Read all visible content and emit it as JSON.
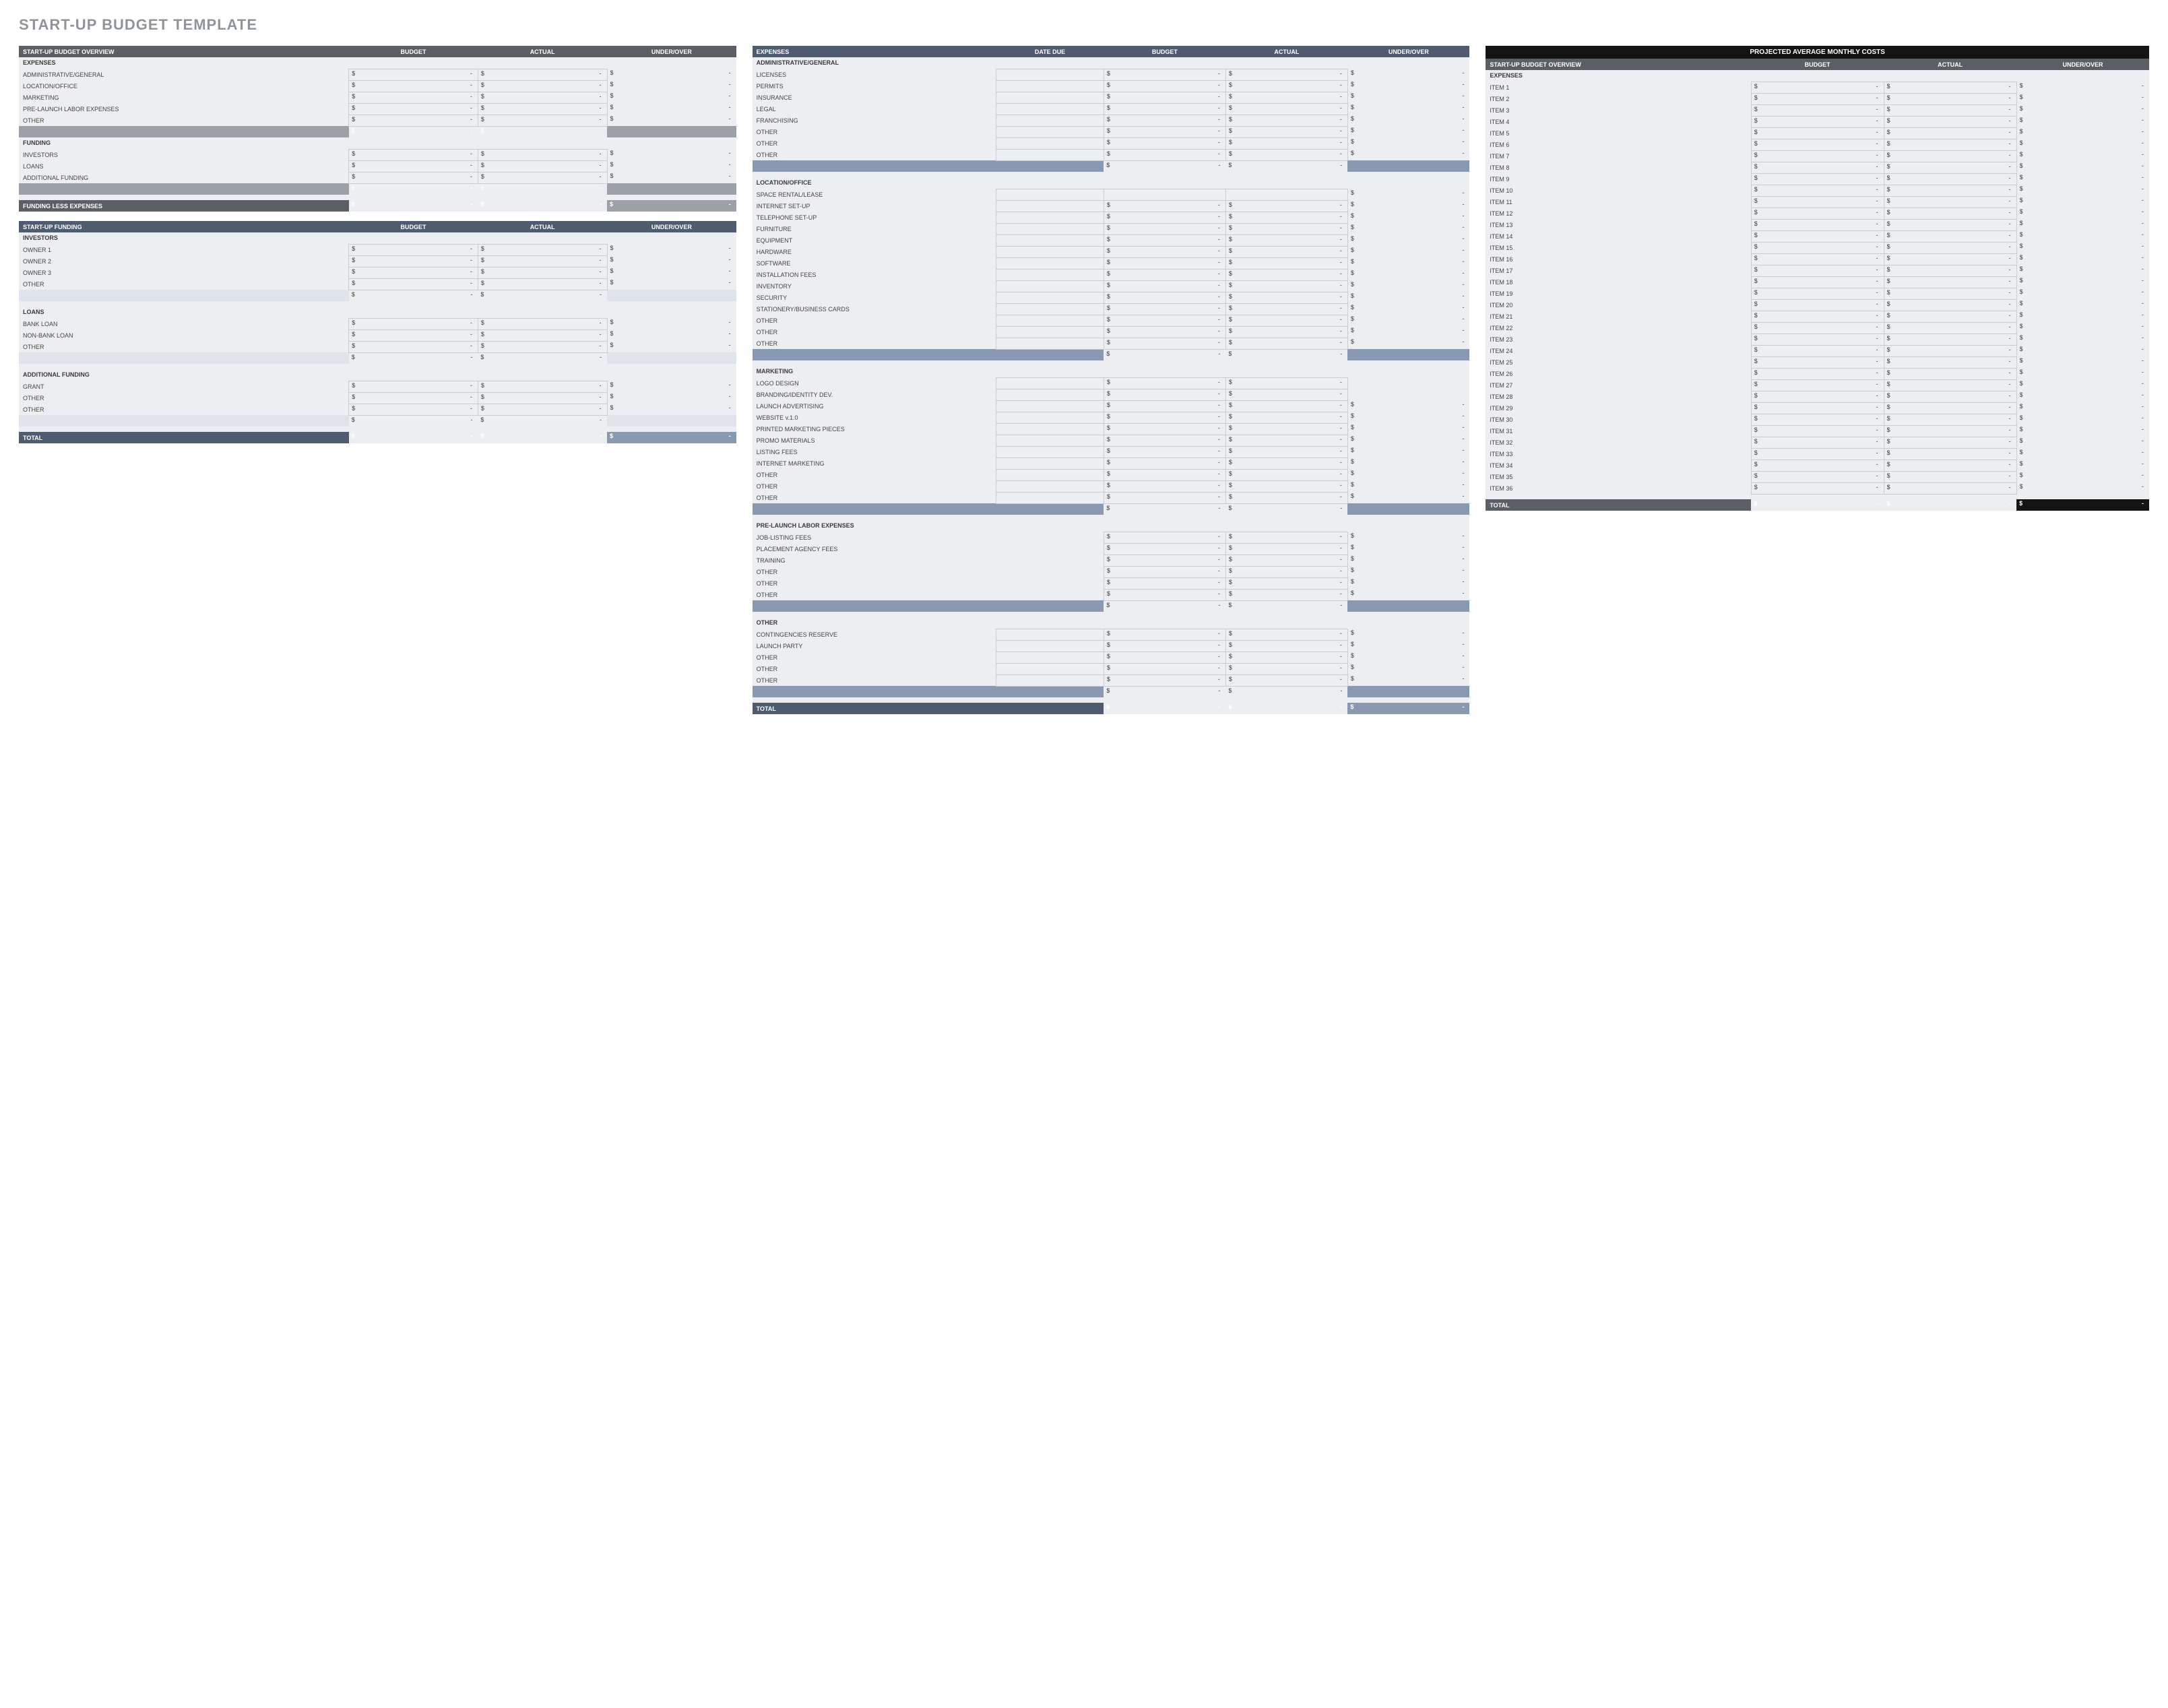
{
  "title": "START-UP BUDGET TEMPLATE",
  "cols": {
    "budget": "BUDGET",
    "actual": "ACTUAL",
    "under": "UNDER/OVER",
    "date": "DATE DUE"
  },
  "sym": {
    "dollar": "$",
    "dash": "-"
  },
  "overview": {
    "title": "START-UP BUDGET OVERVIEW",
    "expenses": {
      "label": "EXPENSES",
      "items": [
        "ADMINISTRATIVE/GENERAL",
        "LOCATION/OFFICE",
        "MARKETING",
        "PRE-LAUNCH LABOR EXPENSES",
        "OTHER"
      ]
    },
    "funding": {
      "label": "FUNDING",
      "items": [
        "INVESTORS",
        "LOANS",
        "ADDITIONAL FUNDING"
      ]
    },
    "less": "FUNDING LESS EXPENSES"
  },
  "startfund": {
    "title": "START-UP FUNDING",
    "sections": [
      {
        "label": "INVESTORS",
        "items": [
          "OWNER 1",
          "OWNER 2",
          "OWNER 3",
          "OTHER"
        ]
      },
      {
        "label": "LOANS",
        "items": [
          "BANK LOAN",
          "NON-BANK LOAN",
          "OTHER"
        ]
      },
      {
        "label": "ADDITIONAL FUNDING",
        "items": [
          "GRANT",
          "OTHER",
          "OTHER"
        ]
      }
    ],
    "total": "TOTAL"
  },
  "expenses": {
    "title": "EXPENSES",
    "sections": [
      {
        "label": "ADMINISTRATIVE/GENERAL",
        "items": [
          "LICENSES",
          "PERMITS",
          "INSURANCE",
          "LEGAL",
          "FRANCHISING",
          "OTHER",
          "OTHER",
          "OTHER"
        ]
      },
      {
        "label": "LOCATION/OFFICE",
        "firstNoAmts": true,
        "items": [
          "SPACE RENTAL/LEASE",
          "INTERNET SET-UP",
          "TELEPHONE SET-UP",
          "FURNITURE",
          "EQUIPMENT",
          "HARDWARE",
          "SOFTWARE",
          "INSTALLATION FEES",
          "INVENTORY",
          "SECURITY",
          "STATIONERY/BUSINESS CARDS",
          "OTHER",
          "OTHER",
          "OTHER"
        ]
      },
      {
        "label": "MARKETING",
        "specialFirstTwo": true,
        "items": [
          "LOGO DESIGN",
          "BRANDING/IDENTITY DEV.",
          "LAUNCH ADVERTISING",
          "WEBSITE v.1.0",
          "PRINTED MARKETING PIECES",
          "PROMO MATERIALS",
          "LISTING FEES",
          "INTERNET MARKETING",
          "OTHER",
          "OTHER",
          "OTHER"
        ]
      },
      {
        "label": "PRE-LAUNCH LABOR EXPENSES",
        "noDate": true,
        "items": [
          "JOB-LISTING FEES",
          "PLACEMENT AGENCY FEES",
          "TRAINING",
          "OTHER",
          "OTHER",
          "OTHER"
        ]
      },
      {
        "label": "OTHER",
        "items": [
          "CONTINGENCIES RESERVE",
          "LAUNCH PARTY",
          "OTHER",
          "OTHER",
          "OTHER"
        ]
      }
    ],
    "total": "TOTAL"
  },
  "monthly": {
    "supertitle": "PROJECTED AVERAGE MONTHLY COSTS",
    "title": "START-UP BUDGET OVERVIEW",
    "section": "EXPENSES",
    "items": [
      "ITEM 1",
      "ITEM 2",
      "ITEM 3",
      "ITEM 4",
      "ITEM 5",
      "ITEM 6",
      "ITEM 7",
      "ITEM 8",
      "ITEM 9",
      "ITEM 10",
      "ITEM 11",
      "ITEM 12",
      "ITEM 13",
      "ITEM 14",
      "ITEM 15",
      "ITEM 16",
      "ITEM 17",
      "ITEM 18",
      "ITEM 19",
      "ITEM 20",
      "ITEM 21",
      "ITEM 22",
      "ITEM 23",
      "ITEM 24",
      "ITEM 25",
      "ITEM 26",
      "ITEM 27",
      "ITEM 28",
      "ITEM 29",
      "ITEM 30",
      "ITEM 31",
      "ITEM 32",
      "ITEM 33",
      "ITEM 34",
      "ITEM 35",
      "ITEM 36"
    ],
    "total": "TOTAL"
  }
}
